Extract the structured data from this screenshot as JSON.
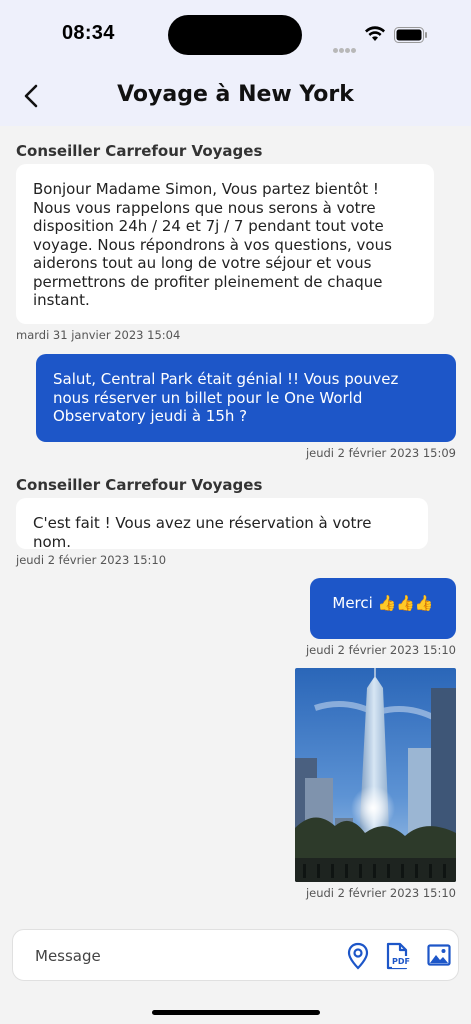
{
  "status_bar": {
    "time": "08:34"
  },
  "header": {
    "title": "Voyage à New York"
  },
  "messages": [
    {
      "sender": "Conseiller Carrefour Voyages",
      "text": "Bonjour Madame Simon, Vous partez bientôt ! Nous vous rappelons que nous serons à votre disposition 24h / 24 et 7j / 7 pendant tout vote voyage. Nous répondrons à vos questions, vous aiderons tout au long de votre séjour et vous permettrons de profiter pleinement de chaque instant.",
      "timestamp": "mardi 31 janvier 2023 15:04"
    },
    {
      "text": "Salut, Central Park était génial !! Vous pouvez nous réserver un billet pour le One World Observatory jeudi à 15h ?",
      "timestamp": "jeudi 2 février 2023 15:09"
    },
    {
      "sender": "Conseiller Carrefour Voyages",
      "text": "C'est fait ! Vous avez une réservation à votre nom.",
      "timestamp": "jeudi 2 février 2023 15:10"
    },
    {
      "text": "Merci 👍👍👍",
      "timestamp": "jeudi 2 février 2023 15:10"
    },
    {
      "image": "one-world-trade-center-photo",
      "timestamp": "jeudi 2 février 2023 15:10"
    }
  ],
  "composer": {
    "placeholder": "Message",
    "icons": [
      "location-icon",
      "pdf-icon",
      "image-icon"
    ],
    "pdf_label": "PDF"
  },
  "colors": {
    "accent": "#1d56c8",
    "header_bg": "#eef0fb",
    "page_bg": "#f3f3f3"
  }
}
